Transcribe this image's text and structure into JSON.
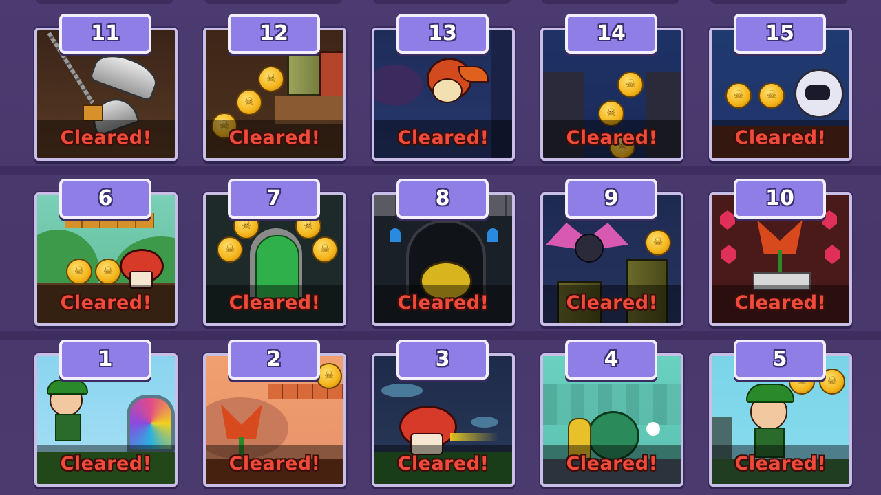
{
  "screen": {
    "background": "#4a3a6e"
  },
  "cleared_label": "Cleared!",
  "levels": [
    {
      "number": "11",
      "status": "Cleared!",
      "scene": "swinging-axe-cave"
    },
    {
      "number": "12",
      "status": "Cleared!",
      "scene": "cave-coins-pipe"
    },
    {
      "number": "13",
      "status": "Cleared!",
      "scene": "night-forest-dragon"
    },
    {
      "number": "14",
      "status": "Cleared!",
      "scene": "night-cliff-coins"
    },
    {
      "number": "15",
      "status": "Cleared!",
      "scene": "night-ghost-coins"
    },
    {
      "number": "6",
      "status": "Cleared!",
      "scene": "green-hills-mushroom"
    },
    {
      "number": "7",
      "status": "Cleared!",
      "scene": "castle-green-door"
    },
    {
      "number": "8",
      "status": "Cleared!",
      "scene": "castle-slime"
    },
    {
      "number": "9",
      "status": "Cleared!",
      "scene": "night-bat-pipes"
    },
    {
      "number": "10",
      "status": "Cleared!",
      "scene": "piranha-plant-gems"
    },
    {
      "number": "1",
      "status": "Cleared!",
      "scene": "hero-portal"
    },
    {
      "number": "2",
      "status": "Cleared!",
      "scene": "sunset-piranha"
    },
    {
      "number": "3",
      "status": "Cleared!",
      "scene": "night-mushroom-dash"
    },
    {
      "number": "4",
      "status": "Cleared!",
      "scene": "forest-snail"
    },
    {
      "number": "5",
      "status": "Cleared!",
      "scene": "hero-coins"
    }
  ],
  "colors": {
    "badge": "#8f7ee6",
    "badge_border": "#f2eefc",
    "tile_border": "#c9bfe6",
    "cleared_text": "#f04a3a"
  }
}
